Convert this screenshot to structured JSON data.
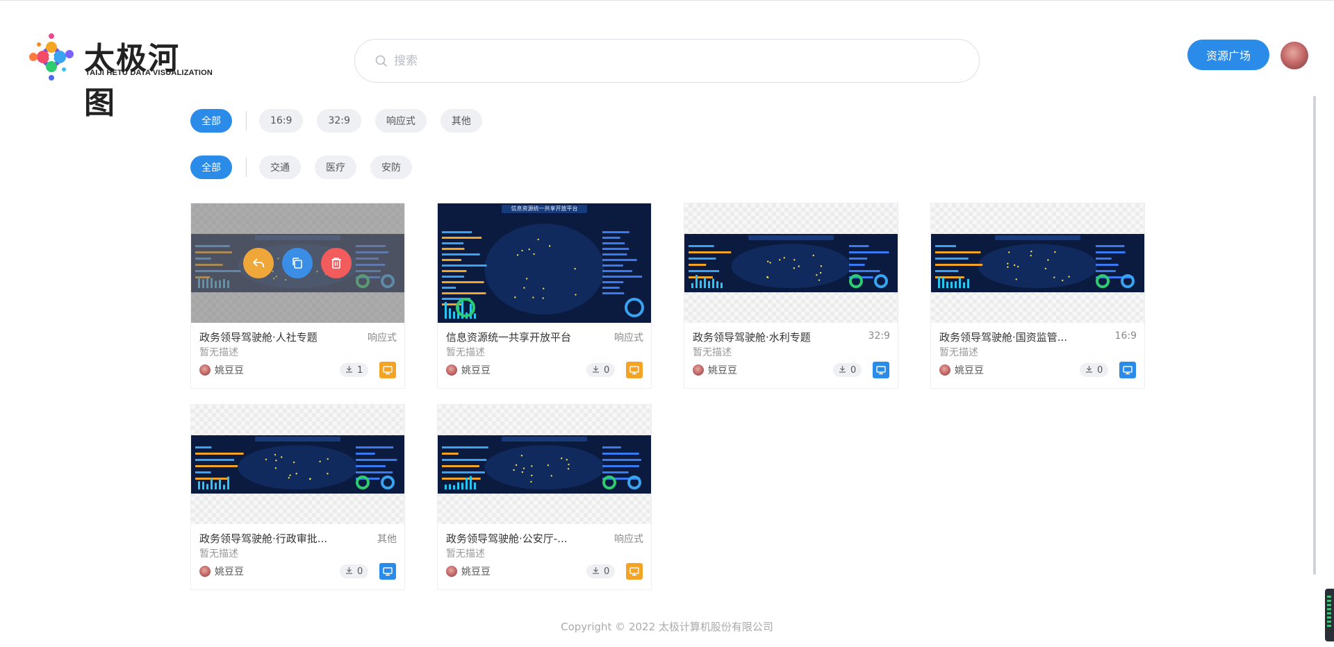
{
  "header": {
    "logo_title": "太极河图",
    "logo_subtitle": "TAIJI HETU DATA VISUALIZATION",
    "search_placeholder": "搜索",
    "resource_button": "资源广场"
  },
  "filters": {
    "ratio": [
      "全部",
      "16:9",
      "32:9",
      "响应式",
      "其他"
    ],
    "category": [
      "全部",
      "交通",
      "医疗",
      "安防"
    ],
    "ratio_active": "全部",
    "category_active": "全部"
  },
  "cards": [
    {
      "title": "政务领导驾驶舱·人社专题",
      "ratio": "响应式",
      "desc": "暂无描述",
      "author": "姚豆豆",
      "downloads": "1",
      "device": "orange",
      "device_icon": "monitor-icon",
      "hovered": true,
      "thumb_style": "wide"
    },
    {
      "title": "信息资源统一共享开放平台",
      "ratio": "响应式",
      "desc": "暂无描述",
      "author": "姚豆豆",
      "downloads": "0",
      "device": "orange",
      "device_icon": "monitor-icon",
      "hovered": false,
      "thumb_style": "full",
      "thumb_caption": "信息资源统一共享开放平台"
    },
    {
      "title": "政务领导驾驶舱·水利专题",
      "ratio": "32:9",
      "desc": "暂无描述",
      "author": "姚豆豆",
      "downloads": "0",
      "device": "blue",
      "device_icon": "monitor-icon",
      "hovered": false,
      "thumb_style": "wide"
    },
    {
      "title": "政务领导驾驶舱·国资监管...",
      "ratio": "16:9",
      "desc": "暂无描述",
      "author": "姚豆豆",
      "downloads": "0",
      "device": "blue",
      "device_icon": "monitor-icon",
      "hovered": false,
      "thumb_style": "wide"
    },
    {
      "title": "政务领导驾驶舱·行政审批...",
      "ratio": "其他",
      "desc": "暂无描述",
      "author": "姚豆豆",
      "downloads": "0",
      "device": "blue",
      "device_icon": "monitor-icon",
      "hovered": false,
      "thumb_style": "wide"
    },
    {
      "title": "政务领导驾驶舱·公安厅-...",
      "ratio": "响应式",
      "desc": "暂无描述",
      "author": "姚豆豆",
      "downloads": "0",
      "device": "orange",
      "device_icon": "monitor-icon",
      "hovered": false,
      "thumb_style": "wide"
    }
  ],
  "overlay_actions": [
    {
      "icon": "reply-icon",
      "color": "#f0a73a"
    },
    {
      "icon": "copy-icon",
      "color": "#3a8ee6"
    },
    {
      "icon": "trash-icon",
      "color": "#f25c5c"
    }
  ],
  "colors": {
    "accent": "#2a8be8",
    "orange": "#f3a427",
    "chip_bg": "#eef0f4"
  },
  "footer": {
    "copyright": "Copyright © 2022 太极计算机股份有限公司"
  }
}
